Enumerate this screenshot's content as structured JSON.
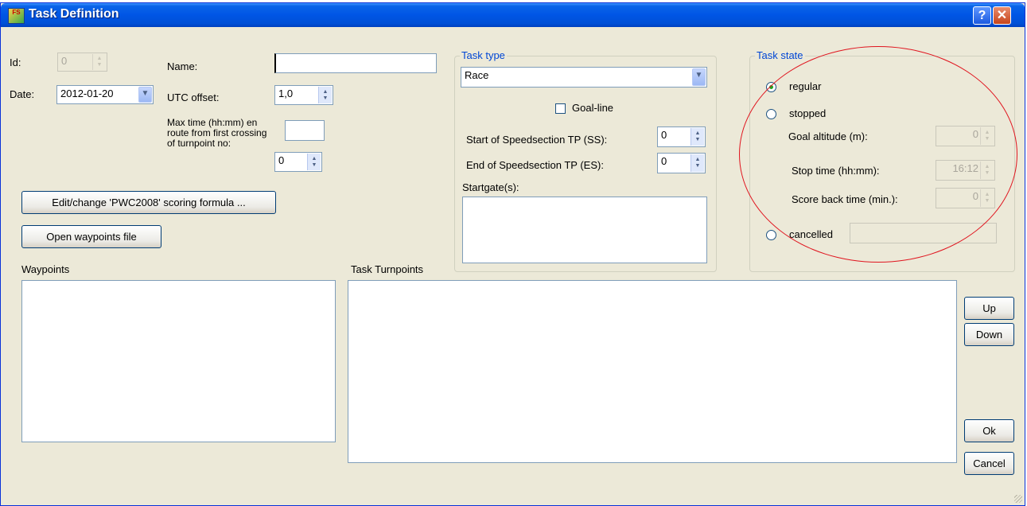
{
  "window": {
    "title": "Task Definition",
    "help_glyph": "?",
    "close_glyph": "✕",
    "app_icon_text": "FS"
  },
  "general": {
    "id_label": "Id:",
    "id_value": "0",
    "date_label": "Date:",
    "date_value": "2012-01-20",
    "name_label": "Name:",
    "name_value": "",
    "utc_label": "UTC offset:",
    "utc_value": "1,0",
    "maxtime_label": "Max time (hh:mm) en route from first crossing of turnpoint no:",
    "maxtime_value": "",
    "turnpoint_no_value": "0",
    "scoring_button": "Edit/change 'PWC2008' scoring formula ...",
    "open_waypoints_button": "Open waypoints file"
  },
  "task_type": {
    "group_title": "Task type",
    "selected": "Race",
    "goal_line_label": "Goal-line",
    "goal_line_checked": false,
    "ss_label": "Start of Speedsection TP (SS):",
    "ss_value": "0",
    "es_label": "End of Speedsection TP (ES):",
    "es_value": "0",
    "startgates_label": "Startgate(s):"
  },
  "task_state": {
    "group_title": "Task state",
    "options": [
      "regular",
      "stopped",
      "cancelled"
    ],
    "selected": "regular",
    "goal_altitude_label": "Goal altitude (m):",
    "goal_altitude_value": "0",
    "stop_time_label": "Stop time (hh:mm):",
    "stop_time_value": "16:12",
    "score_back_label": "Score back time (min.):",
    "score_back_value": "0",
    "cancelled_reason": ""
  },
  "lists": {
    "waypoints_label": "Waypoints",
    "turnpoints_label": "Task Turnpoints"
  },
  "buttons": {
    "up": "Up",
    "down": "Down",
    "ok": "Ok",
    "cancel": "Cancel"
  },
  "colors": {
    "title_bar": "#0055e5",
    "dialog_face": "#ece9d8",
    "group_title": "#0046d5",
    "annotation_circle": "#e0141e"
  }
}
